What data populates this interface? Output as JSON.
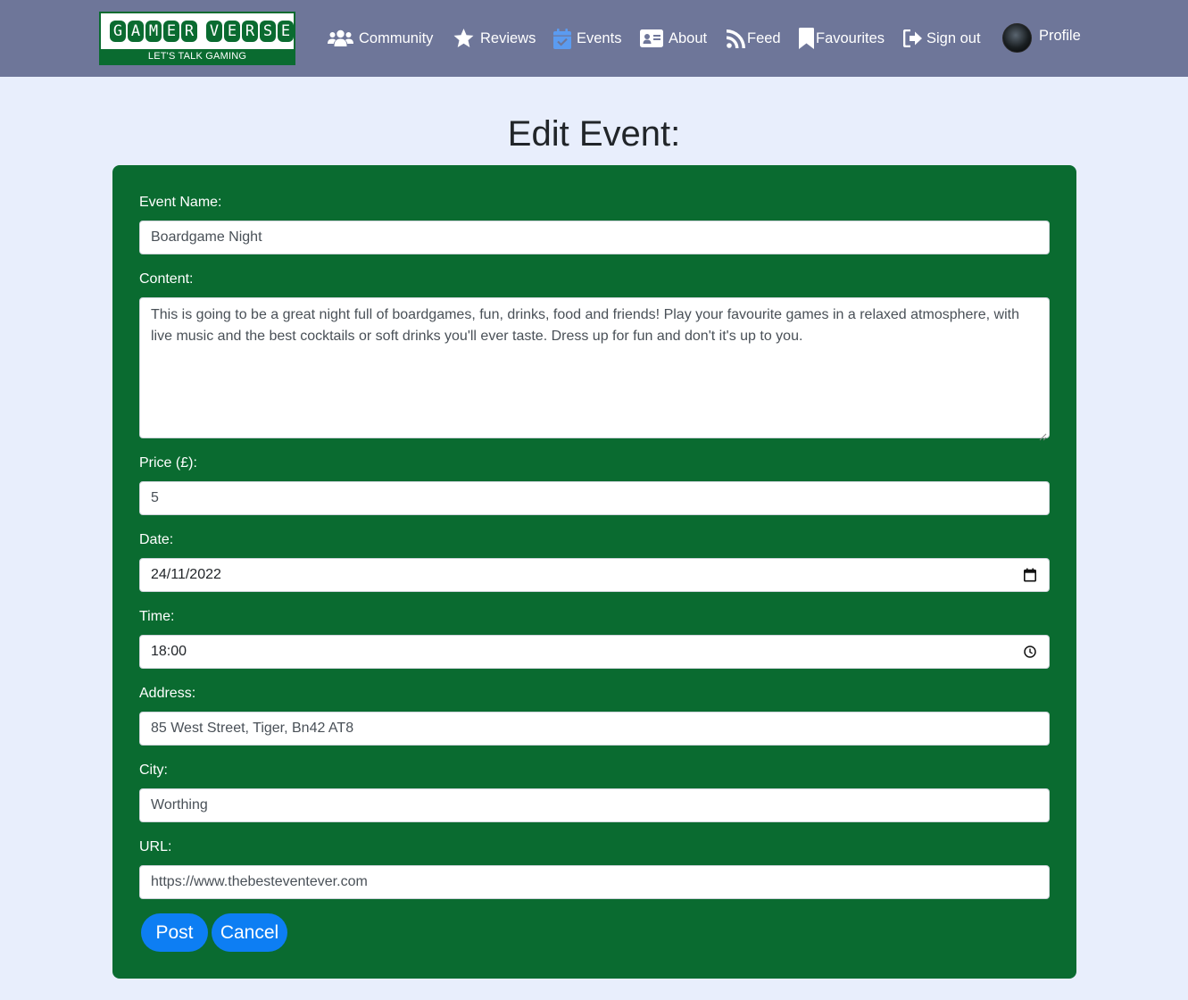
{
  "logo": {
    "top_letters": [
      "G",
      "A",
      "M",
      "E",
      "R",
      "V",
      "E",
      "R",
      "S",
      "E"
    ],
    "tagline": "LET'S TALK GAMING"
  },
  "nav": {
    "community": "Community",
    "reviews": "Reviews",
    "events": "Events",
    "about": "About",
    "feed": "Feed",
    "favourites": "Favourites",
    "signout": "Sign out",
    "profile": "Profile"
  },
  "icons": {
    "community": "users-icon",
    "reviews": "star-icon",
    "events": "calendar-check-icon",
    "about": "id-card-icon",
    "feed": "rss-icon",
    "favourites": "bookmark-icon",
    "signout": "sign-out-icon",
    "date": "calendar-icon",
    "time": "clock-icon"
  },
  "colors": {
    "navbar": "#6e7699",
    "page_bg": "#e8eefc",
    "card": "#0a6b30",
    "button": "#0d7ef3",
    "events_active": "#5b9bf0"
  },
  "page_title": "Edit Event:",
  "form": {
    "name_label": "Event Name:",
    "name_value": "Boardgame Night",
    "content_label": "Content:",
    "content_value": "This is going to be a great night full of boardgames, fun, drinks, food and friends! Play your favourite games in a relaxed atmosphere, with live music and the best cocktails or soft drinks you'll ever taste. Dress up for fun and don't it's up to you.",
    "price_label": "Price (£):",
    "price_value": "5",
    "date_label": "Date:",
    "date_value": "24/11/2022",
    "time_label": "Time:",
    "time_value": "18:00",
    "address_label": "Address:",
    "address_value": "85 West Street, Tiger, Bn42 AT8",
    "city_label": "City:",
    "city_value": "Worthing",
    "url_label": "URL:",
    "url_value": "https://www.thebesteventever.com",
    "post_label": "Post",
    "cancel_label": "Cancel"
  }
}
